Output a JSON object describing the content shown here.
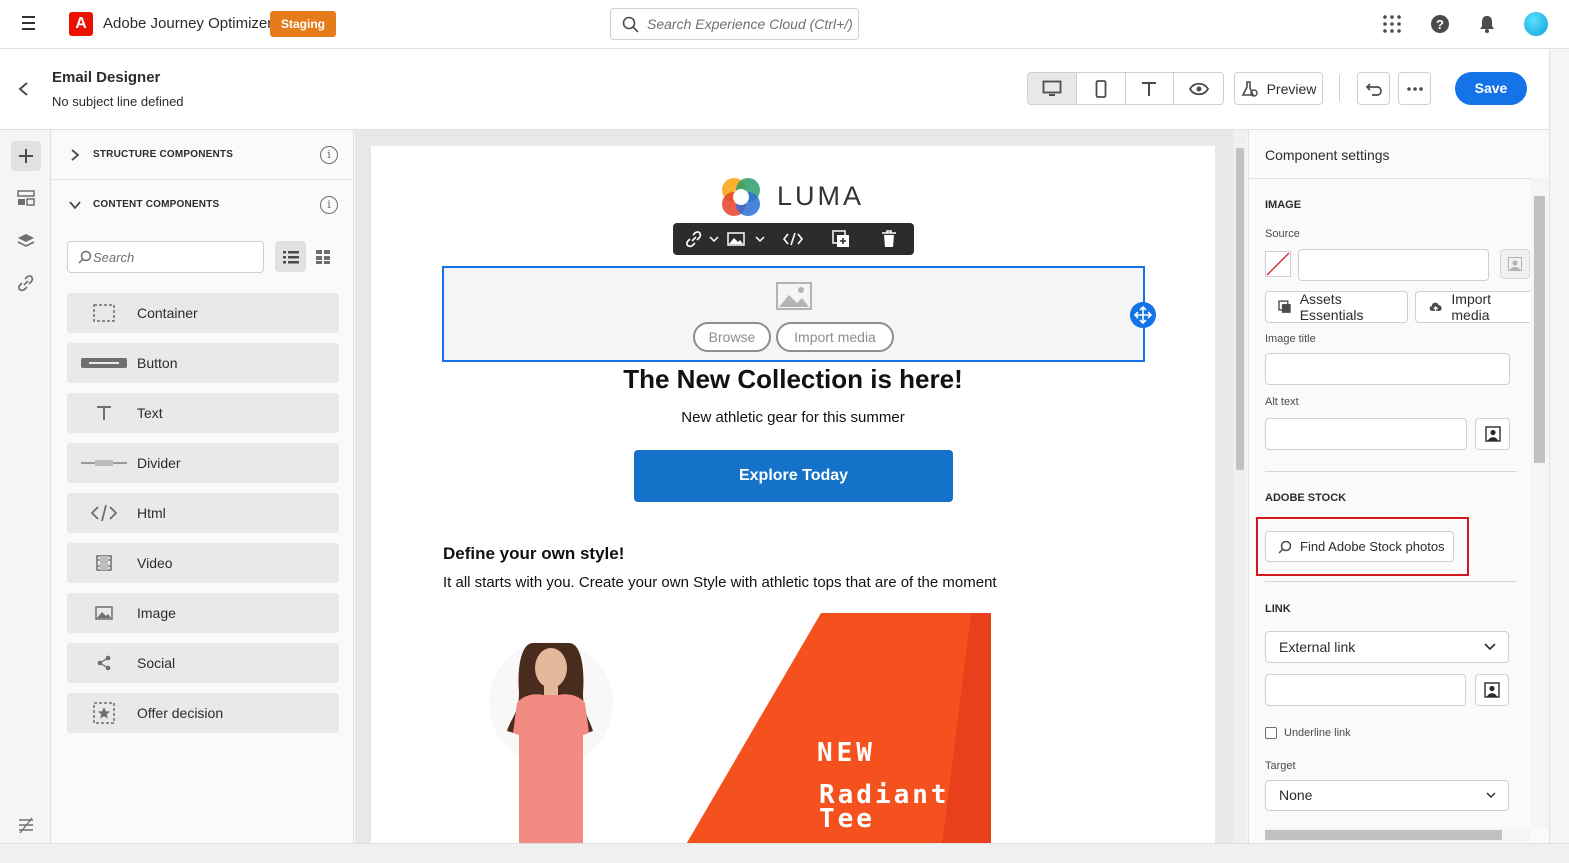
{
  "topbar": {
    "app_name": "Adobe Journey Optimizer",
    "env_badge": "Staging",
    "search_placeholder": "Search Experience Cloud (Ctrl+/)"
  },
  "header": {
    "title": "Email Designer",
    "subtitle": "No subject line defined",
    "preview_label": "Preview",
    "save_label": "Save"
  },
  "left_panel": {
    "structure_label": "STRUCTURE COMPONENTS",
    "content_label": "CONTENT COMPONENTS",
    "search_placeholder": "Search",
    "components": [
      {
        "label": "Container",
        "icon": "container-icon"
      },
      {
        "label": "Button",
        "icon": "button-icon"
      },
      {
        "label": "Text",
        "icon": "text-icon"
      },
      {
        "label": "Divider",
        "icon": "divider-icon"
      },
      {
        "label": "Html",
        "icon": "html-icon"
      },
      {
        "label": "Video",
        "icon": "video-icon"
      },
      {
        "label": "Image",
        "icon": "image-icon"
      },
      {
        "label": "Social",
        "icon": "share-icon"
      },
      {
        "label": "Offer decision",
        "icon": "offer-icon"
      }
    ]
  },
  "email": {
    "brand": "LUMA",
    "browse_label": "Browse",
    "import_label": "Import media",
    "headline": "The New Collection is here!",
    "subheadline": "New athletic gear for this summer",
    "cta_label": "Explore Today",
    "section_title": "Define your own style!",
    "section_body": "It all starts with you. Create your own Style with athletic tops that are of the moment",
    "promo_line1": "NEW",
    "promo_line2": "Radiant",
    "promo_line3": "Tee"
  },
  "right_panel": {
    "title": "Component settings",
    "image_section": "IMAGE",
    "source_label": "Source",
    "assets_btn": "Assets Essentials",
    "import_btn": "Import media",
    "image_title_label": "Image title",
    "alt_text_label": "Alt text",
    "stock_section": "ADOBE STOCK",
    "stock_btn": "Find Adobe Stock photos",
    "link_section": "LINK",
    "link_type": "External link",
    "underline_label": "Underline link",
    "target_label": "Target",
    "target_value": "None"
  },
  "colors": {
    "accent": "#1473e6",
    "staging": "#e57b1a",
    "highlight": "#d3181c",
    "cta": "#1473c8",
    "promo": "#f4511e"
  }
}
